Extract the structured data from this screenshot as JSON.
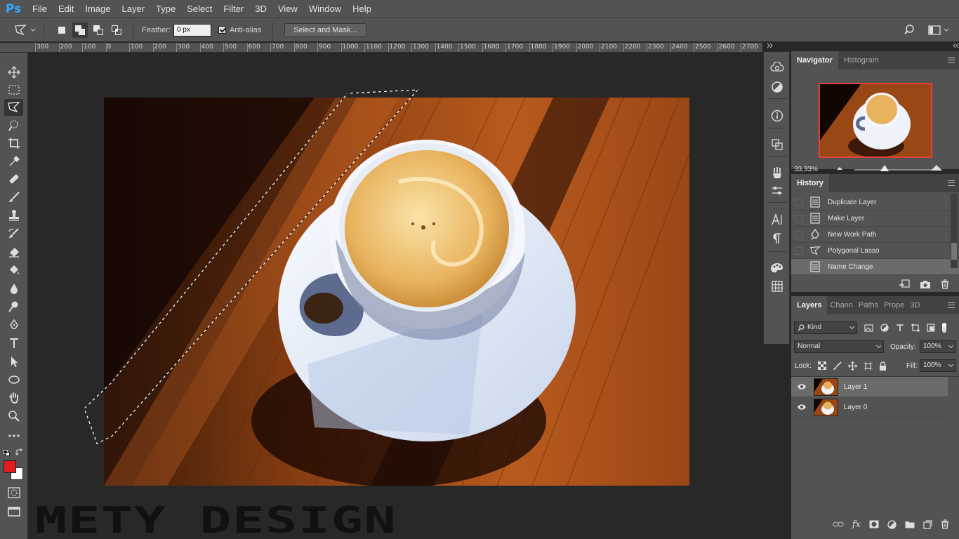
{
  "app": {
    "logo": "Ps"
  },
  "menu": [
    "File",
    "Edit",
    "Image",
    "Layer",
    "Type",
    "Select",
    "Filter",
    "3D",
    "View",
    "Window",
    "Help"
  ],
  "options": {
    "feather_label": "Feather:",
    "feather_value": "0 px",
    "antialias_label": "Anti-alias",
    "select_mask_label": "Select and Mask..."
  },
  "ruler": [
    "300",
    "200",
    "100",
    "0",
    "100",
    "200",
    "300",
    "400",
    "500",
    "600",
    "700",
    "800",
    "900",
    "1000",
    "1100",
    "1200",
    "1300",
    "1400",
    "1500",
    "1600",
    "1700",
    "1800",
    "1900",
    "2000",
    "2100",
    "2200",
    "2300",
    "2400",
    "2500",
    "2600",
    "2700"
  ],
  "navigator": {
    "tabs": [
      "Navigator",
      "Histogram"
    ],
    "zoom": "33,33%",
    "zoom_level": 0.37
  },
  "history": {
    "title": "History",
    "items": [
      {
        "label": "Duplicate Layer",
        "icon": "document-icon"
      },
      {
        "label": "Make Layer",
        "icon": "document-icon"
      },
      {
        "label": "New Work Path",
        "icon": "pen-icon"
      },
      {
        "label": "Polygonal Lasso",
        "icon": "polygonal-lasso-icon"
      },
      {
        "label": "Name Change",
        "icon": "document-icon"
      }
    ]
  },
  "layers": {
    "tabs": [
      "Layers",
      "Chann",
      "Paths",
      "Prope",
      "3D"
    ],
    "filter_kind": "Kind",
    "blend_mode": "Normal",
    "opacity_label": "Opacity:",
    "opacity_value": "100%",
    "lock_label": "Lock:",
    "fill_label": "Fill:",
    "fill_value": "100%",
    "items": [
      {
        "name": "Layer 1"
      },
      {
        "name": "Layer 0"
      }
    ]
  },
  "watermark": "METY DESIGN",
  "colors": {
    "foreground": "#e21b1b",
    "background": "#ffffff",
    "accent": "#31a8ff"
  }
}
